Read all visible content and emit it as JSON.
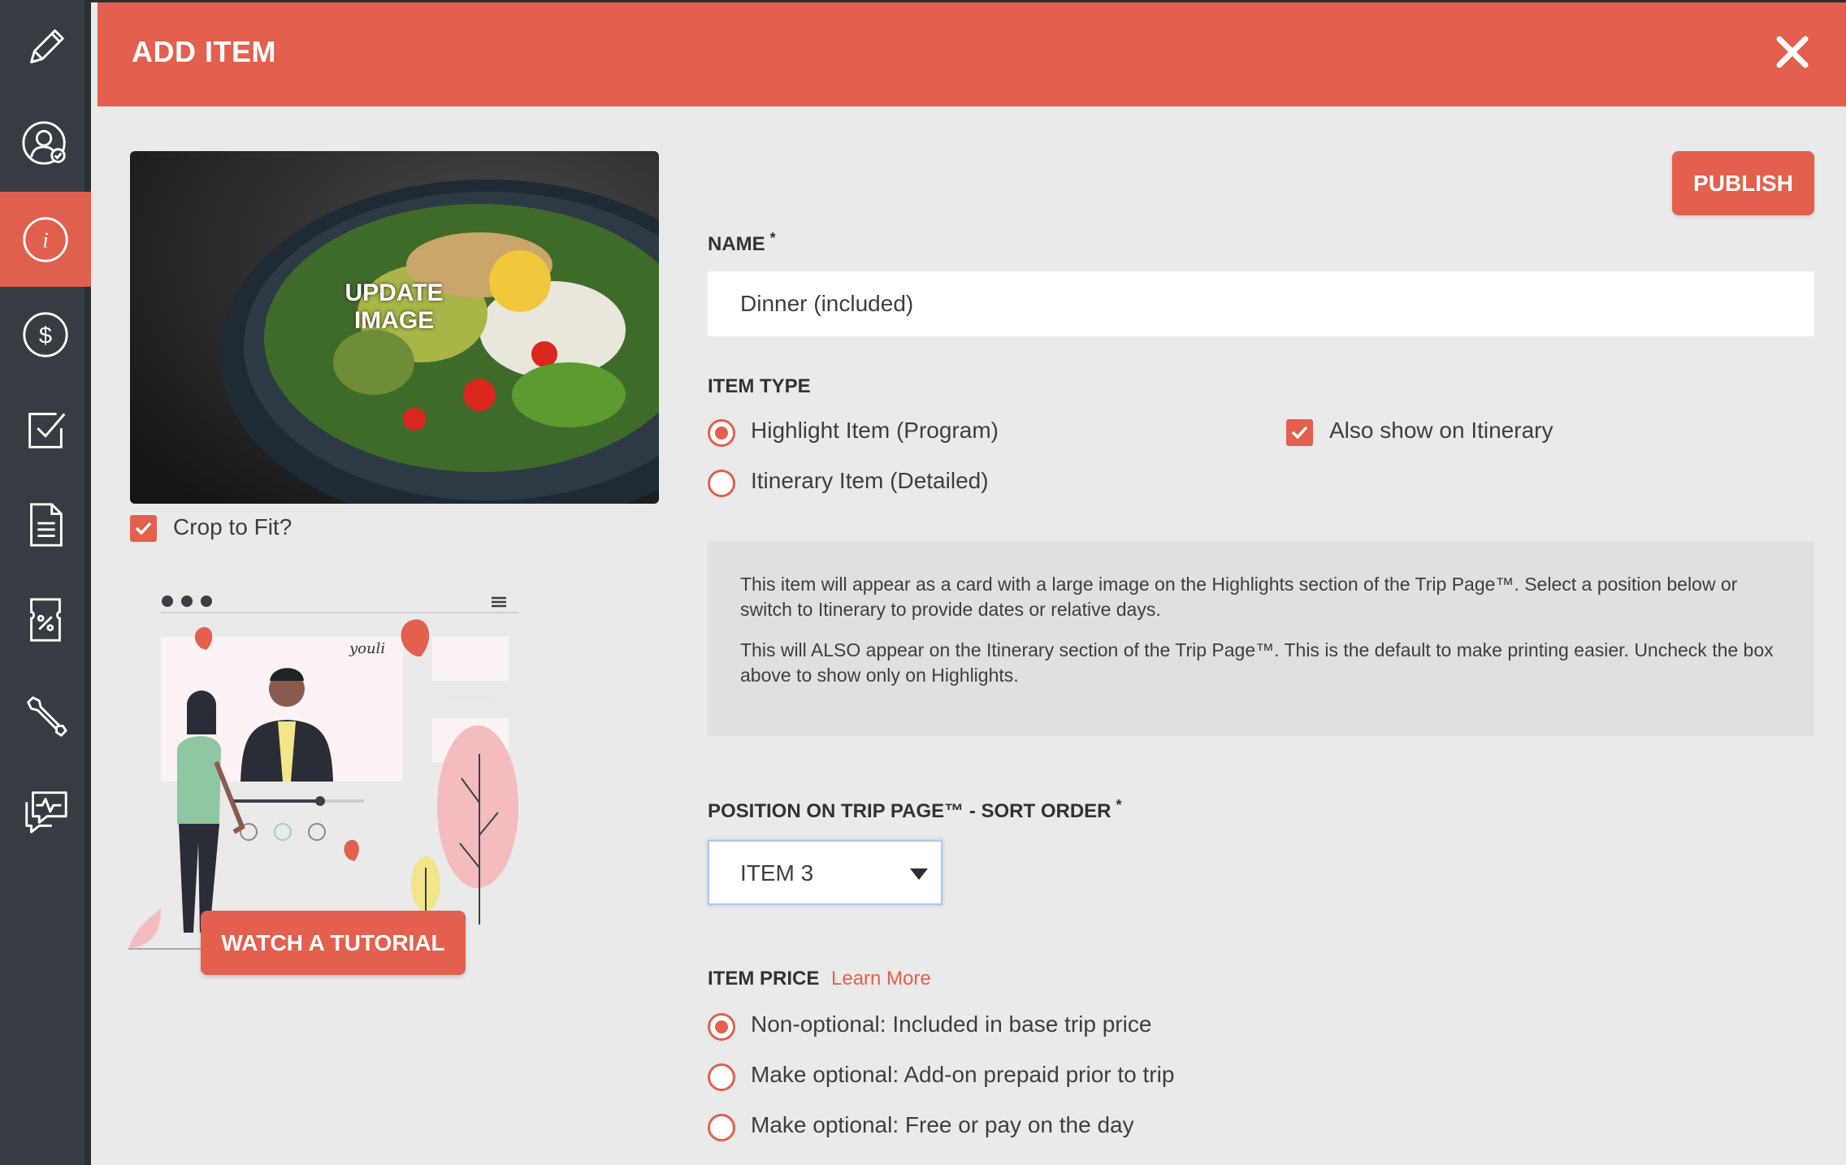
{
  "colors": {
    "accent": "#e2604d",
    "sidebar": "#363c41",
    "background": "#e9eae9"
  },
  "sidebar": {
    "items": [
      {
        "icon": "pencil-icon",
        "active": false
      },
      {
        "icon": "user-check-icon",
        "active": false
      },
      {
        "icon": "info-icon",
        "active": true
      },
      {
        "icon": "dollar-icon",
        "active": false
      },
      {
        "icon": "checkbox-icon",
        "active": false
      },
      {
        "icon": "document-icon",
        "active": false
      },
      {
        "icon": "discount-ticket-icon",
        "active": false
      },
      {
        "icon": "wrench-icon",
        "active": false
      },
      {
        "icon": "chat-pulse-icon",
        "active": false
      }
    ]
  },
  "header": {
    "title": "ADD ITEM",
    "close_icon": "close-icon"
  },
  "image": {
    "overlay_label": "UPDATE IMAGE",
    "description": "salad-bowl-photo"
  },
  "crop": {
    "label": "Crop to Fit?",
    "checked": true
  },
  "tutorial": {
    "label": "WATCH A TUTORIAL",
    "brand": "youli"
  },
  "publish_label": "PUBLISH",
  "name_field": {
    "label": "NAME",
    "required_mark": "*",
    "value": "Dinner (included)"
  },
  "item_type": {
    "label": "ITEM TYPE",
    "options": [
      {
        "label": "Highlight Item (Program)",
        "checked": true
      },
      {
        "label": "Itinerary Item (Detailed)",
        "checked": false
      }
    ],
    "also_show": {
      "label": "Also show on Itinerary",
      "checked": true
    }
  },
  "info": {
    "paragraph1": "This item will appear as a card with a large image on the Highlights section of the Trip Page™. Select a position below or switch to Itinerary to provide dates or relative days.",
    "paragraph2": "This will ALSO appear on the Itinerary section of the Trip Page™. This is the default to make printing easier. Uncheck the box above to show only on Highlights."
  },
  "position": {
    "label": "POSITION ON TRIP PAGE™ - SORT ORDER",
    "required_mark": "*",
    "selected": "ITEM 3"
  },
  "item_price": {
    "label": "ITEM PRICE",
    "learn_more": "Learn More",
    "options": [
      {
        "label": "Non-optional: Included in base trip price",
        "checked": true
      },
      {
        "label": "Make optional: Add-on prepaid prior to trip",
        "checked": false
      },
      {
        "label": "Make optional: Free or pay on the day",
        "checked": false
      }
    ]
  }
}
